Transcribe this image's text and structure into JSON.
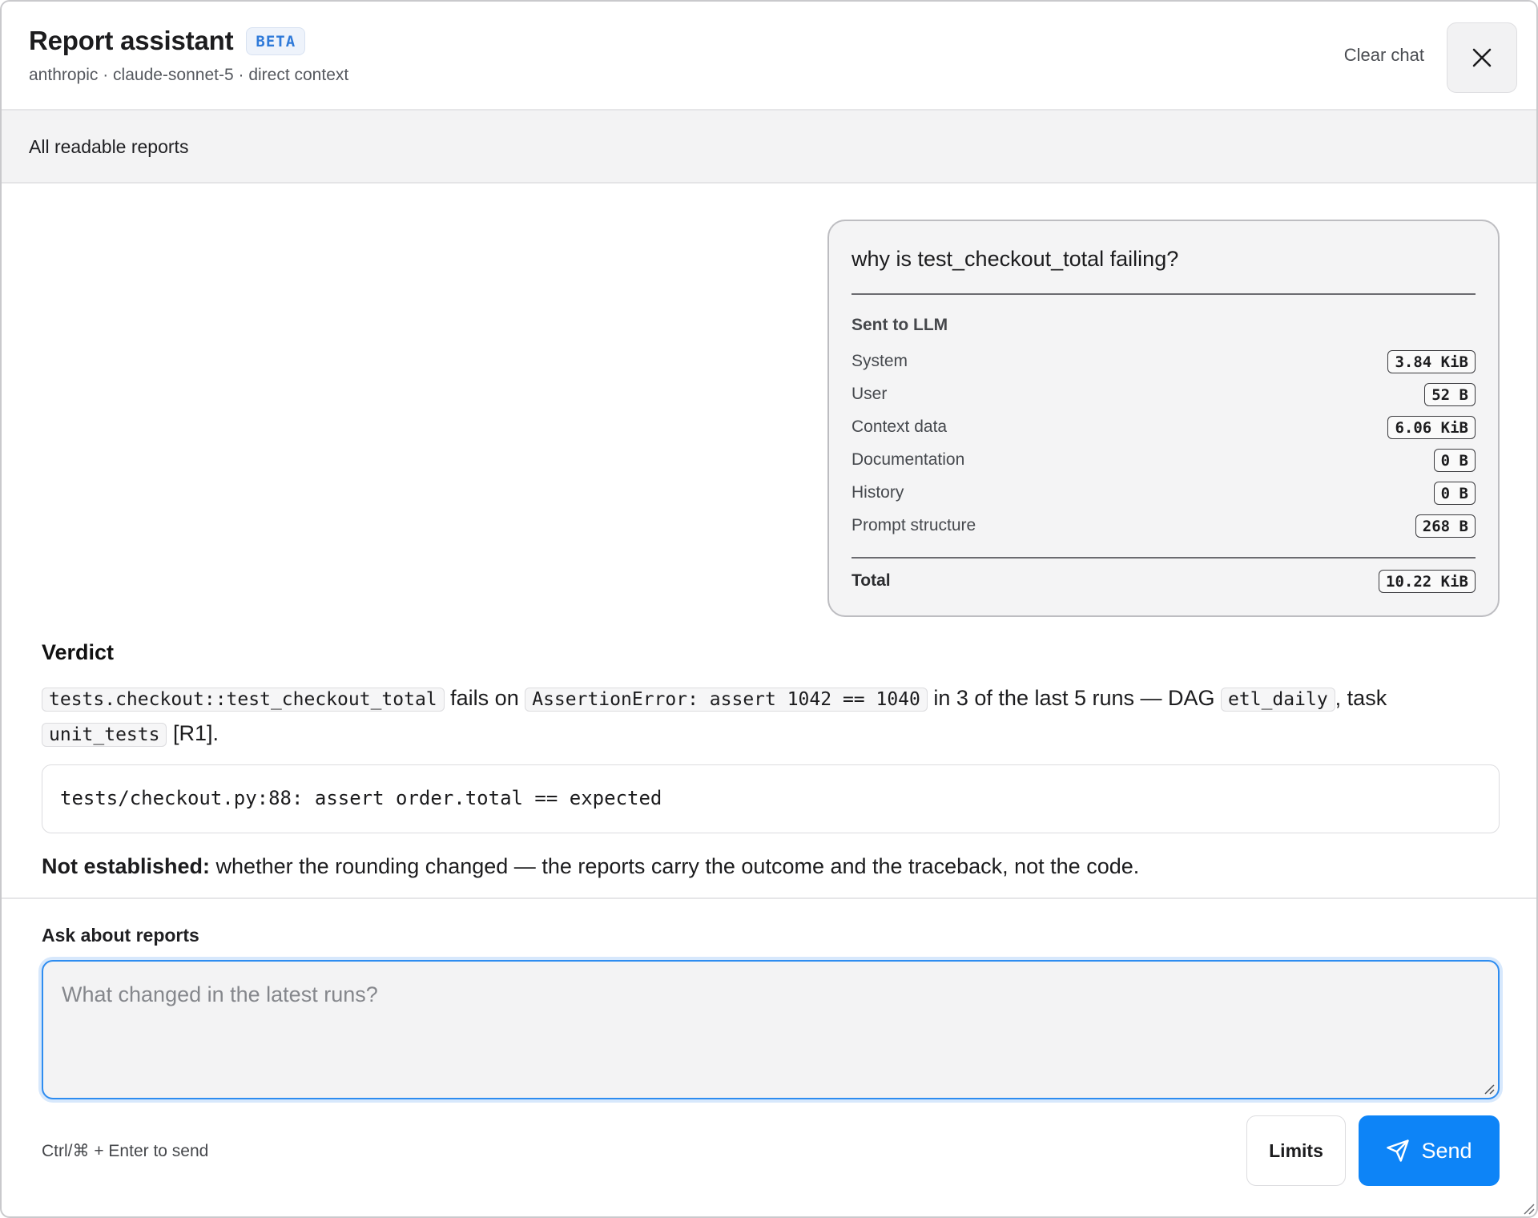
{
  "header": {
    "title": "Report assistant",
    "badge": "BETA",
    "subtitle": "anthropic · claude-sonnet-5 · direct context",
    "clear_label": "Clear chat",
    "close_icon": "close-icon"
  },
  "scope": {
    "label": "All readable reports"
  },
  "user_message": {
    "text": "why is test_checkout_total failing?",
    "sent_title": "Sent to LLM",
    "metrics": [
      {
        "label": "System",
        "value": "3.84 KiB"
      },
      {
        "label": "User",
        "value": "52 B"
      },
      {
        "label": "Context data",
        "value": "6.06 KiB"
      },
      {
        "label": "Documentation",
        "value": "0 B"
      },
      {
        "label": "History",
        "value": "0 B"
      },
      {
        "label": "Prompt structure",
        "value": "268 B"
      }
    ],
    "total": {
      "label": "Total",
      "value": "10.22 KiB"
    }
  },
  "answer": {
    "heading": "Verdict",
    "code1": "tests.checkout::test_checkout_total",
    "text1": " fails on ",
    "code2": "AssertionError: assert 1042 == 1040",
    "text2": " in 3 of the last 5 runs — DAG ",
    "code3": "etl_daily",
    "text3": ", task ",
    "code4": "unit_tests",
    "text4": " [R1].",
    "code_block": "tests/checkout.py:88: assert order.total == expected",
    "not_established_label": "Not established:",
    "not_established_text": " whether the rounding changed — the reports carry the outcome and the traceback, not the code."
  },
  "composer": {
    "label": "Ask about reports",
    "placeholder": "What changed in the latest runs?",
    "hint": "Ctrl/⌘ + Enter to send",
    "limits_label": "Limits",
    "send_label": "Send",
    "send_icon": "paper-plane-icon",
    "accent": "#0d84f7"
  }
}
